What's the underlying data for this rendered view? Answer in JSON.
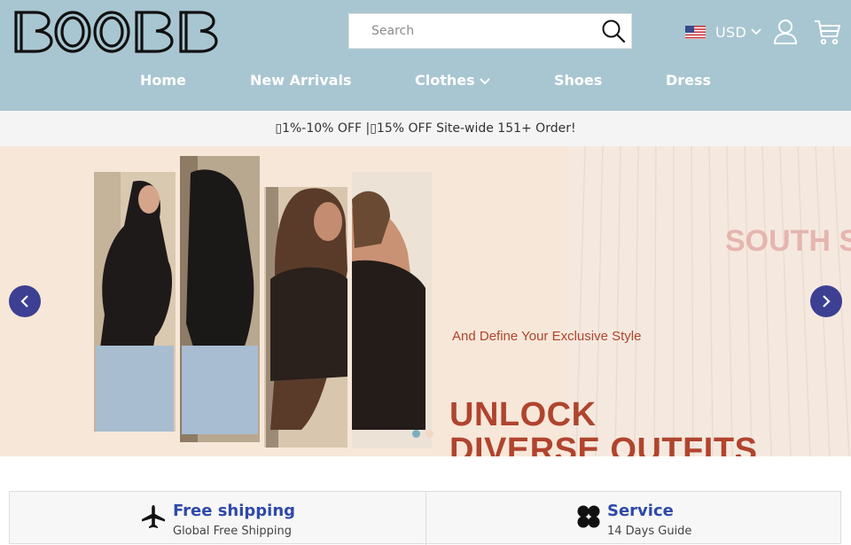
{
  "brand": {
    "logo_text": "BOOBB"
  },
  "search": {
    "placeholder": "Search"
  },
  "currency": {
    "code": "USD",
    "flag_icon": "us-flag-icon"
  },
  "header_icons": {
    "account": "user-icon",
    "cart": "cart-icon"
  },
  "nav": {
    "items": [
      {
        "label": "Home"
      },
      {
        "label": "New Arrivals"
      },
      {
        "label": "Clothes",
        "has_dropdown": true
      },
      {
        "label": "Shoes"
      },
      {
        "label": "Dress"
      }
    ]
  },
  "announcement": {
    "text": "▯1%-10% OFF |▯15% OFF Site-wide 151+ Order!"
  },
  "banner": {
    "headline_line1": "UNLOCK",
    "headline_line2": "DIVERSE OUTFITS",
    "subheadline": "And Define Your Exclusive Style",
    "shirt_print": "SOUTH ST",
    "slide_count": 2,
    "active_slide": 1
  },
  "features": [
    {
      "title": "Free shipping",
      "subtitle": "Global Free Shipping",
      "icon": "airplane-icon"
    },
    {
      "title": "Service",
      "subtitle": "14 Days Guide",
      "icon": "clover-icon"
    }
  ],
  "colors": {
    "header_bg": "#a8c6d1",
    "accent": "#3d3f92",
    "headline": "#b0442e",
    "feature_title": "#2f49a8"
  }
}
